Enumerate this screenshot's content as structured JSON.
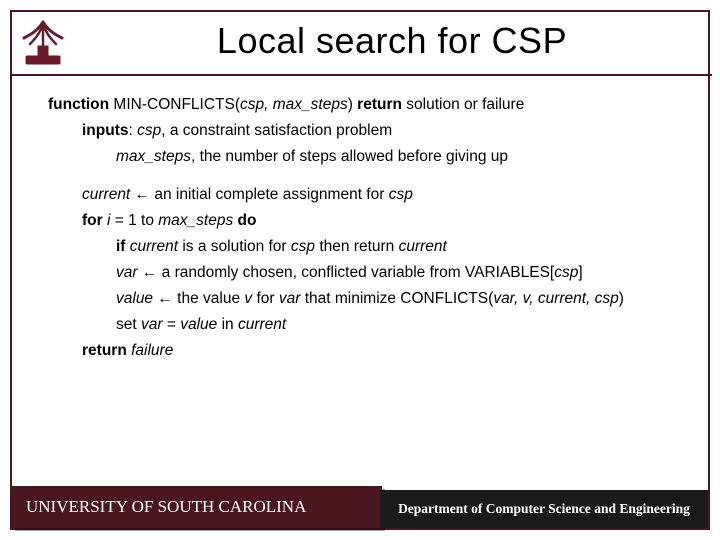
{
  "title": "Local search for CSP",
  "algo": {
    "sig_kw1": "function",
    "sig_name": " MIN-CONFLICTS(",
    "sig_args": "csp, max_steps",
    "sig_paren": ") ",
    "sig_kw2": "return",
    "sig_tail": " solution or failure",
    "inputs_kw": "inputs",
    "inputs1a": ": ",
    "inputs1b": "csp",
    "inputs1c": ", a constraint satisfaction problem",
    "inputs2a": "max_steps",
    "inputs2b": ", the number of steps allowed before giving up",
    "l1a": "current",
    "l1b": " ←   an initial complete assignment for ",
    "l1c": "csp",
    "l2a": "for",
    "l2b": " i",
    "l2c": " = 1 to ",
    "l2d": "max_steps",
    "l2e": " ",
    "l2f": "do",
    "l3a": "if",
    "l3b": " current",
    "l3c": " is a solution for ",
    "l3d": "csp",
    "l3e": " then return ",
    "l3f": "current",
    "l4a": "var",
    "l4b": " ←  a randomly chosen, conflicted variable from VARIABLES[",
    "l4c": "csp",
    "l4d": "]",
    "l5a": "value",
    "l5b": "  ←  the value ",
    "l5c": "v",
    "l5d": " for ",
    "l5e": "var",
    "l5f": " that minimize CONFLICTS(",
    "l5g": "var, v, current, csp",
    "l5h": ")",
    "l6a": "set ",
    "l6b": "var",
    "l6c": " = ",
    "l6d": "value",
    "l6e": " in ",
    "l6f": "current",
    "l7a": "return",
    "l7b": " failure"
  },
  "footer": {
    "left": "UNIVERSITY OF SOUTH CAROLINA",
    "right": "Department of Computer Science and Engineering"
  }
}
